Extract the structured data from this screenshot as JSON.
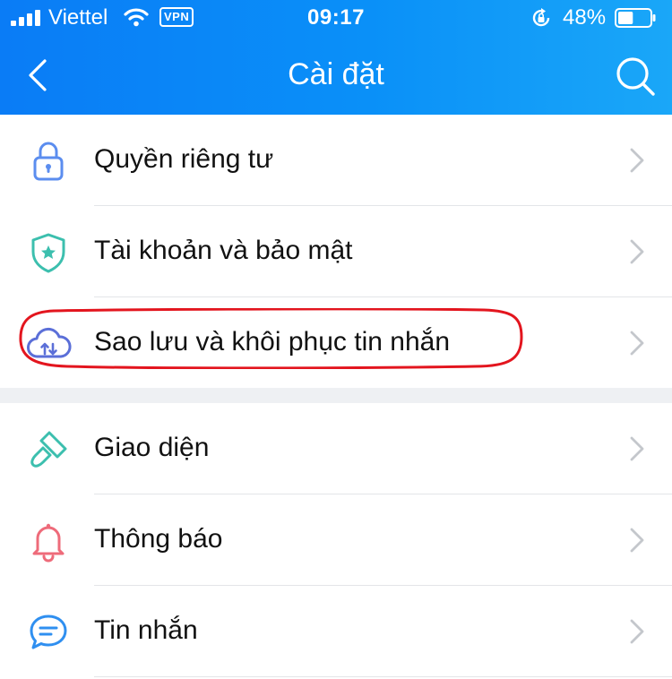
{
  "status_bar": {
    "carrier": "Viettel",
    "vpn": "VPN",
    "time": "09:17",
    "battery": "48%",
    "battery_level": 0.48
  },
  "nav": {
    "title": "Cài đặt",
    "back_icon": "chevron-left-icon",
    "search_icon": "search-icon"
  },
  "settings": {
    "group1": [
      {
        "label": "Quyền riêng tư",
        "icon": "lock-icon",
        "color": "#5b8def"
      },
      {
        "label": "Tài khoản và bảo mật",
        "icon": "shield-star-icon",
        "color": "#3cbfae"
      },
      {
        "label": "Sao lưu và khôi phục tin nhắn",
        "icon": "cloud-sync-icon",
        "color": "#5b6fd8"
      }
    ],
    "group2": [
      {
        "label": "Giao diện",
        "icon": "paint-brush-icon",
        "color": "#3cbfae"
      },
      {
        "label": "Thông báo",
        "icon": "bell-icon",
        "color": "#ee6b7a"
      },
      {
        "label": "Tin nhắn",
        "icon": "chat-bubble-icon",
        "color": "#2f8ff0"
      }
    ]
  },
  "colors": {
    "header_blue": "#0a85f7",
    "highlight_red": "#e3151e",
    "chevron_gray": "#c4c7cc"
  }
}
